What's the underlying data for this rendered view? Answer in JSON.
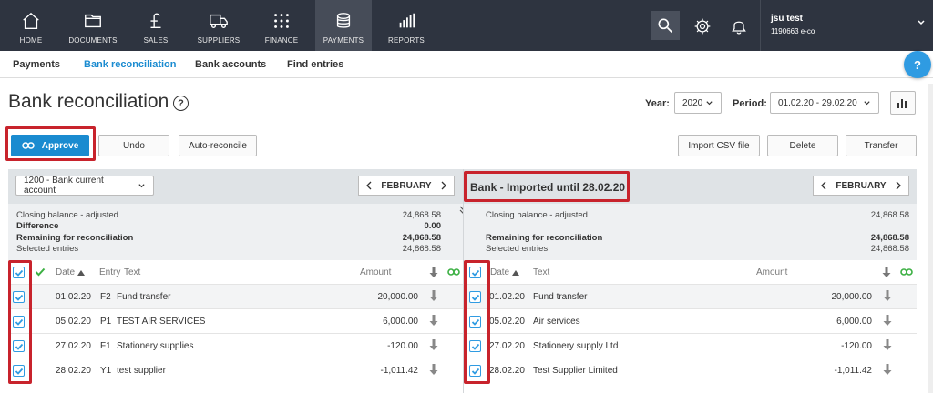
{
  "nav": {
    "items": [
      {
        "label": "HOME",
        "icon": "home-icon"
      },
      {
        "label": "DOCUMENTS",
        "icon": "folder-icon"
      },
      {
        "label": "SALES",
        "icon": "pound-icon"
      },
      {
        "label": "SUPPLIERS",
        "icon": "truck-icon"
      },
      {
        "label": "FINANCE",
        "icon": "grid-icon"
      },
      {
        "label": "PAYMENTS",
        "icon": "coins-icon"
      },
      {
        "label": "REPORTS",
        "icon": "bar-chart-icon"
      }
    ],
    "active": "PAYMENTS"
  },
  "user": {
    "name": "jsu test",
    "company": "1190663 e-co"
  },
  "subnav": {
    "items": [
      "Payments",
      "Bank reconciliation",
      "Bank accounts",
      "Find entries"
    ],
    "active": "Bank reconciliation"
  },
  "help_label": "?",
  "page": {
    "title": "Bank reconciliation",
    "title_help": "?"
  },
  "filters": {
    "year_label": "Year:",
    "year_value": "2020",
    "period_label": "Period:",
    "period_value": "01.02.20 - 29.02.20"
  },
  "actions": {
    "approve": "Approve",
    "undo": "Undo",
    "auto_reconcile": "Auto-reconcile",
    "import_csv": "Import CSV file",
    "delete": "Delete",
    "transfer": "Transfer"
  },
  "left": {
    "account": "1200 - Bank current account",
    "month": "FEBRUARY",
    "summary": [
      {
        "label": "Closing balance - adjusted",
        "value": "24,868.58",
        "bold": false
      },
      {
        "label": "Difference",
        "value": "0.00",
        "bold": true
      },
      {
        "label": "Remaining for reconciliation",
        "value": "24,868.58",
        "bold": true
      },
      {
        "label": "Selected entries",
        "value": "24,868.58",
        "bold": false
      }
    ],
    "headers": {
      "date": "Date",
      "entry": "Entry",
      "text": "Text",
      "amount": "Amount"
    },
    "rows": [
      {
        "date": "01.02.20",
        "entry": "F2",
        "text": "Fund transfer",
        "amount": "20,000.00"
      },
      {
        "date": "05.02.20",
        "entry": "P1",
        "text": "TEST AIR SERVICES",
        "amount": "6,000.00"
      },
      {
        "date": "27.02.20",
        "entry": "F1",
        "text": "Stationery supplies",
        "amount": "-120.00"
      },
      {
        "date": "28.02.20",
        "entry": "Y1",
        "text": "test supplier",
        "amount": "-1,011.42"
      }
    ]
  },
  "right": {
    "title": "Bank - Imported until 28.02.20",
    "month": "FEBRUARY",
    "summary": [
      {
        "label": "Closing balance - adjusted",
        "value": "24,868.58",
        "bold": false
      },
      {
        "label": "Remaining for reconciliation",
        "value": "24,868.58",
        "bold": true
      },
      {
        "label": "Selected entries",
        "value": "24,868.58",
        "bold": false
      }
    ],
    "headers": {
      "date": "Date",
      "text": "Text",
      "amount": "Amount"
    },
    "rows": [
      {
        "date": "01.02.20",
        "text": "Fund transfer",
        "amount": "20,000.00"
      },
      {
        "date": "05.02.20",
        "text": "Air services",
        "amount": "6,000.00"
      },
      {
        "date": "27.02.20",
        "text": "Stationery supply Ltd",
        "amount": "-120.00"
      },
      {
        "date": "28.02.20",
        "text": "Test Supplier Limited",
        "amount": "-1,011.42"
      }
    ]
  },
  "colors": {
    "accent": "#1a8bd0",
    "topbar": "#2e3440",
    "highlight": "#c8232c",
    "link_green": "#3cb043"
  }
}
